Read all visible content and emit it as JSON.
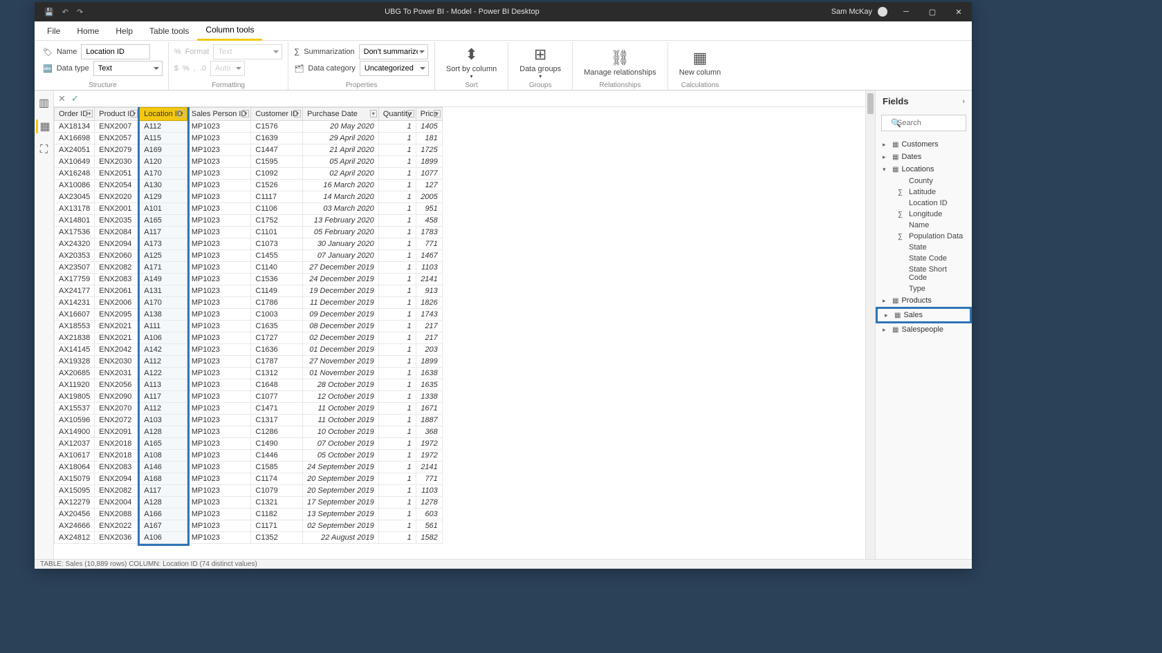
{
  "titlebar": {
    "title": "UBG To Power BI - Model - Power BI Desktop",
    "user": "Sam McKay"
  },
  "menubar": [
    "File",
    "Home",
    "Help",
    "Table tools",
    "Column tools"
  ],
  "menubar_active": 4,
  "ribbon": {
    "structure": {
      "name_label": "Name",
      "name_value": "Location ID",
      "datatype_label": "Data type",
      "datatype_value": "Text"
    },
    "formatting": {
      "format_label": "Format",
      "format_value": "Text",
      "auto": "Auto"
    },
    "properties": {
      "summarization_label": "Summarization",
      "summarization_value": "Don't summarize",
      "datacategory_label": "Data category",
      "datacategory_value": "Uncategorized"
    },
    "sort": "Sort by column",
    "groups": "Data groups",
    "relationships": "Manage relationships",
    "calculations": "New column",
    "group_labels": {
      "structure": "Structure",
      "formatting": "Formatting",
      "properties": "Properties",
      "sort": "Sort",
      "groups": "Groups",
      "relationships": "Relationships",
      "calculations": "Calculations"
    }
  },
  "columns": [
    "Order ID",
    "Product ID",
    "Location ID",
    "Sales Person ID",
    "Customer ID",
    "Purchase Date",
    "Quantity",
    "Price"
  ],
  "selected_col": 2,
  "rows": [
    [
      "AX18134",
      "ENX2007",
      "A112",
      "MP1023",
      "C1576",
      "20 May 2020",
      "1",
      "1405"
    ],
    [
      "AX16698",
      "ENX2057",
      "A115",
      "MP1023",
      "C1639",
      "29 April 2020",
      "1",
      "181"
    ],
    [
      "AX24051",
      "ENX2079",
      "A169",
      "MP1023",
      "C1447",
      "21 April 2020",
      "1",
      "1725"
    ],
    [
      "AX10649",
      "ENX2030",
      "A120",
      "MP1023",
      "C1595",
      "05 April 2020",
      "1",
      "1899"
    ],
    [
      "AX16248",
      "ENX2051",
      "A170",
      "MP1023",
      "C1092",
      "02 April 2020",
      "1",
      "1077"
    ],
    [
      "AX10086",
      "ENX2054",
      "A130",
      "MP1023",
      "C1526",
      "16 March 2020",
      "1",
      "127"
    ],
    [
      "AX23045",
      "ENX2020",
      "A129",
      "MP1023",
      "C1117",
      "14 March 2020",
      "1",
      "2005"
    ],
    [
      "AX13178",
      "ENX2001",
      "A101",
      "MP1023",
      "C1106",
      "03 March 2020",
      "1",
      "951"
    ],
    [
      "AX14801",
      "ENX2035",
      "A165",
      "MP1023",
      "C1752",
      "13 February 2020",
      "1",
      "458"
    ],
    [
      "AX17536",
      "ENX2084",
      "A117",
      "MP1023",
      "C1101",
      "05 February 2020",
      "1",
      "1783"
    ],
    [
      "AX24320",
      "ENX2094",
      "A173",
      "MP1023",
      "C1073",
      "30 January 2020",
      "1",
      "771"
    ],
    [
      "AX20353",
      "ENX2060",
      "A125",
      "MP1023",
      "C1455",
      "07 January 2020",
      "1",
      "1467"
    ],
    [
      "AX23507",
      "ENX2082",
      "A171",
      "MP1023",
      "C1140",
      "27 December 2019",
      "1",
      "1103"
    ],
    [
      "AX17759",
      "ENX2083",
      "A149",
      "MP1023",
      "C1536",
      "24 December 2019",
      "1",
      "2141"
    ],
    [
      "AX24177",
      "ENX2061",
      "A131",
      "MP1023",
      "C1149",
      "19 December 2019",
      "1",
      "913"
    ],
    [
      "AX14231",
      "ENX2006",
      "A170",
      "MP1023",
      "C1786",
      "11 December 2019",
      "1",
      "1826"
    ],
    [
      "AX16607",
      "ENX2095",
      "A138",
      "MP1023",
      "C1003",
      "09 December 2019",
      "1",
      "1743"
    ],
    [
      "AX18553",
      "ENX2021",
      "A111",
      "MP1023",
      "C1635",
      "08 December 2019",
      "1",
      "217"
    ],
    [
      "AX21838",
      "ENX2021",
      "A106",
      "MP1023",
      "C1727",
      "02 December 2019",
      "1",
      "217"
    ],
    [
      "AX14145",
      "ENX2042",
      "A142",
      "MP1023",
      "C1636",
      "01 December 2019",
      "1",
      "203"
    ],
    [
      "AX19328",
      "ENX2030",
      "A112",
      "MP1023",
      "C1787",
      "27 November 2019",
      "1",
      "1899"
    ],
    [
      "AX20685",
      "ENX2031",
      "A122",
      "MP1023",
      "C1312",
      "01 November 2019",
      "1",
      "1638"
    ],
    [
      "AX11920",
      "ENX2056",
      "A113",
      "MP1023",
      "C1648",
      "28 October 2019",
      "1",
      "1635"
    ],
    [
      "AX19805",
      "ENX2090",
      "A117",
      "MP1023",
      "C1077",
      "12 October 2019",
      "1",
      "1338"
    ],
    [
      "AX15537",
      "ENX2070",
      "A112",
      "MP1023",
      "C1471",
      "11 October 2019",
      "1",
      "1671"
    ],
    [
      "AX10596",
      "ENX2072",
      "A103",
      "MP1023",
      "C1317",
      "11 October 2019",
      "1",
      "1887"
    ],
    [
      "AX14900",
      "ENX2091",
      "A128",
      "MP1023",
      "C1286",
      "10 October 2019",
      "1",
      "368"
    ],
    [
      "AX12037",
      "ENX2018",
      "A165",
      "MP1023",
      "C1490",
      "07 October 2019",
      "1",
      "1972"
    ],
    [
      "AX10617",
      "ENX2018",
      "A108",
      "MP1023",
      "C1446",
      "05 October 2019",
      "1",
      "1972"
    ],
    [
      "AX18064",
      "ENX2083",
      "A146",
      "MP1023",
      "C1585",
      "24 September 2019",
      "1",
      "2141"
    ],
    [
      "AX15079",
      "ENX2094",
      "A168",
      "MP1023",
      "C1174",
      "20 September 2019",
      "1",
      "771"
    ],
    [
      "AX15095",
      "ENX2082",
      "A117",
      "MP1023",
      "C1079",
      "20 September 2019",
      "1",
      "1103"
    ],
    [
      "AX12279",
      "ENX2004",
      "A128",
      "MP1023",
      "C1321",
      "17 September 2019",
      "1",
      "1278"
    ],
    [
      "AX20456",
      "ENX2088",
      "A166",
      "MP1023",
      "C1182",
      "13 September 2019",
      "1",
      "603"
    ],
    [
      "AX24666",
      "ENX2022",
      "A167",
      "MP1023",
      "C1171",
      "02 September 2019",
      "1",
      "561"
    ],
    [
      "AX24812",
      "ENX2036",
      "A106",
      "MP1023",
      "C1352",
      "22 August 2019",
      "1",
      "1582"
    ]
  ],
  "col_align": [
    "l",
    "l",
    "l",
    "l",
    "l",
    "date",
    "num",
    "num"
  ],
  "fields": {
    "header": "Fields",
    "search_placeholder": "Search",
    "tables": [
      {
        "name": "Customers",
        "expanded": false
      },
      {
        "name": "Dates",
        "expanded": false
      },
      {
        "name": "Locations",
        "expanded": true,
        "fields": [
          {
            "name": "County"
          },
          {
            "name": "Latitude",
            "sigma": true
          },
          {
            "name": "Location ID"
          },
          {
            "name": "Longitude",
            "sigma": true
          },
          {
            "name": "Name"
          },
          {
            "name": "Population Data",
            "sigma": true
          },
          {
            "name": "State"
          },
          {
            "name": "State Code"
          },
          {
            "name": "State Short Code"
          },
          {
            "name": "Type"
          }
        ]
      },
      {
        "name": "Products",
        "expanded": false
      },
      {
        "name": "Sales",
        "expanded": false,
        "highlight": true
      },
      {
        "name": "Salespeople",
        "expanded": false
      }
    ]
  },
  "statusbar": "TABLE: Sales (10,889 rows)  COLUMN: Location ID (74 distinct values)"
}
